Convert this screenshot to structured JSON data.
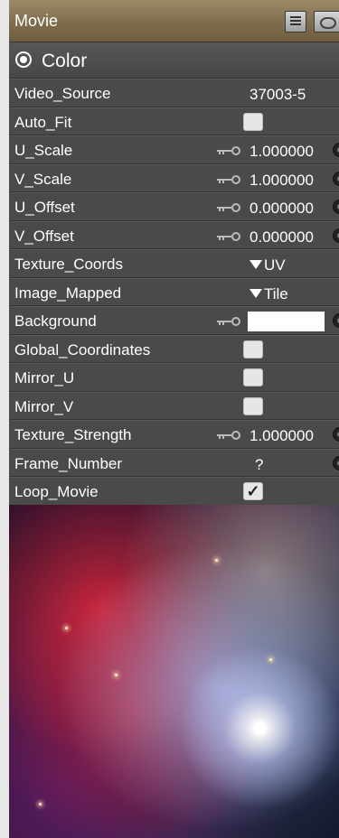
{
  "panel": {
    "title": "Movie"
  },
  "section": {
    "label": "Color"
  },
  "rows": [
    {
      "name": "Video_Source",
      "value": "37003-5"
    },
    {
      "name": "Auto_Fit",
      "checked": false
    },
    {
      "name": "U_Scale",
      "value": "1.000000"
    },
    {
      "name": "V_Scale",
      "value": "1.000000"
    },
    {
      "name": "U_Offset",
      "value": "0.000000"
    },
    {
      "name": "V_Offset",
      "value": "0.000000"
    },
    {
      "name": "Texture_Coords",
      "value": "UV"
    },
    {
      "name": "Image_Mapped",
      "value": "Tile"
    },
    {
      "name": "Background",
      "color": "#ffffff"
    },
    {
      "name": "Global_Coordinates",
      "checked": false
    },
    {
      "name": "Mirror_U",
      "checked": false
    },
    {
      "name": "Mirror_V",
      "checked": false
    },
    {
      "name": "Texture_Strength",
      "value": "1.000000"
    },
    {
      "name": "Frame_Number",
      "value": "?"
    },
    {
      "name": "Loop_Movie",
      "checked": true,
      "check_mark": "✓"
    }
  ],
  "colors": {
    "header": "#8a7853",
    "panel_bg": "#4a4a4a",
    "text": "#ffffff"
  }
}
